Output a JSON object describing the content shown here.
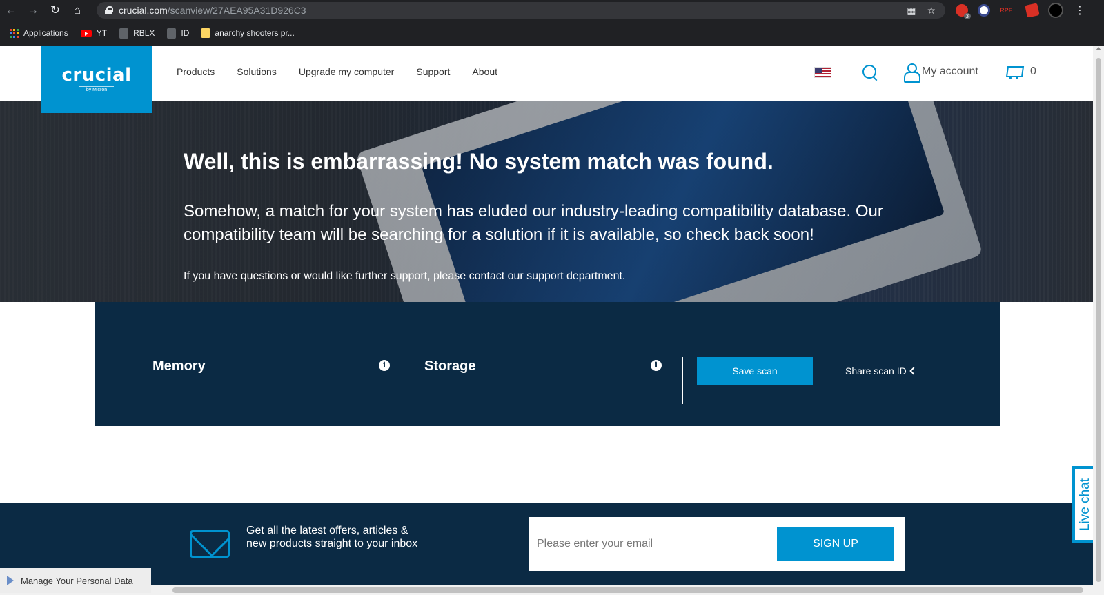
{
  "browser": {
    "url_host": "crucial.com",
    "url_path": "/scanview/27AEA95A31D926C3",
    "ext_badge": "3",
    "ext_tag": "RPE",
    "bookmarks": [
      {
        "label": "Applications"
      },
      {
        "label": "YT"
      },
      {
        "label": "RBLX"
      },
      {
        "label": "ID"
      },
      {
        "label": "anarchy shooters pr..."
      }
    ]
  },
  "header": {
    "logo_text": "crucial",
    "logo_sub": "by Micron",
    "nav": [
      "Products",
      "Solutions",
      "Upgrade my computer",
      "Support",
      "About"
    ],
    "account_label": "My account",
    "cart_count": "0"
  },
  "hero": {
    "title": "Well, this is embarrassing! No system match was found.",
    "paragraph": "Somehow, a match for your system has eluded our industry-leading compatibility database. Our compatibility team will be searching for a solution if it is available, so check back soon!",
    "support_text": "If you have questions or would like further support, please contact our support department."
  },
  "scan": {
    "memory_label": "Memory",
    "storage_label": "Storage",
    "info_glyph": "i",
    "save_label": "Save scan",
    "share_label": "Share scan ID"
  },
  "footer": {
    "offers_text": "Get all the latest offers, articles & new products straight to your inbox",
    "email_placeholder": "Please enter your email",
    "signup_label": "SIGN UP"
  },
  "live_chat_label": "Live chat",
  "manage_data_label": "Manage Your Personal Data",
  "colors": {
    "brand_blue": "#0093d0",
    "navy": "#0b2a44"
  }
}
